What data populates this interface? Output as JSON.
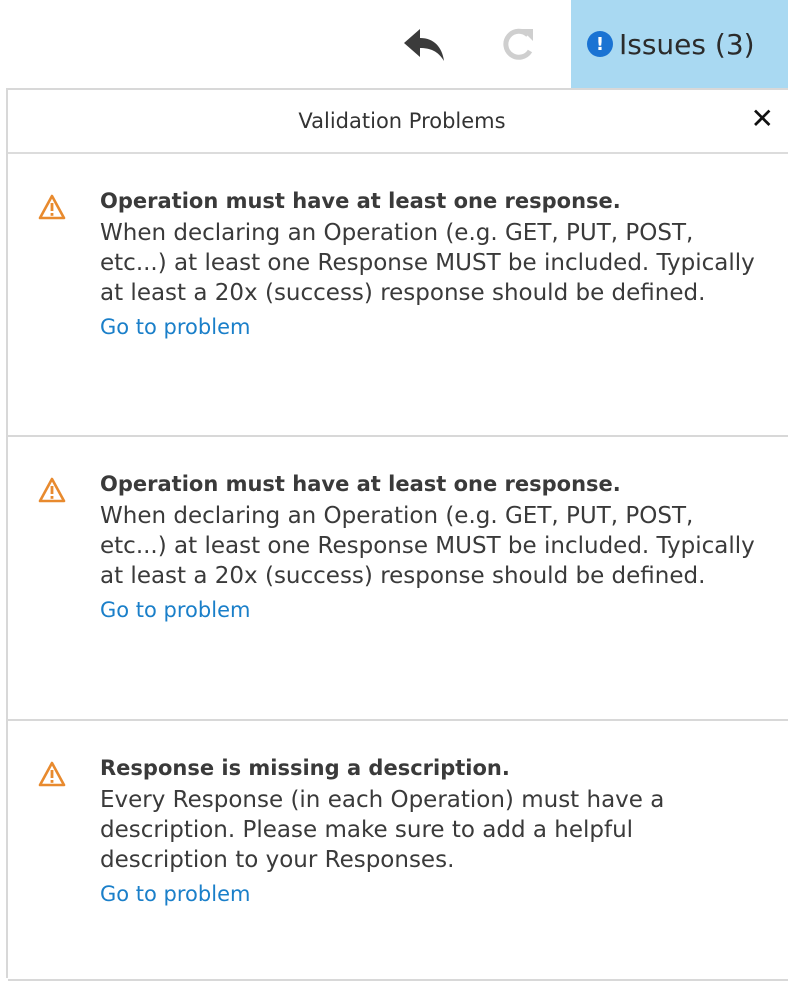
{
  "toolbar": {
    "undo_icon": "undo-arrow-icon",
    "redo_icon": "redo-arrow-icon",
    "issues_label": "Issues (3)",
    "issues_icon": "exclamation-circle-icon",
    "issues_dot_glyph": "!",
    "accent_color": "#a9d9f2"
  },
  "panel": {
    "title": "Validation Problems",
    "close_glyph": "✕"
  },
  "problems": [
    {
      "title": "Operation must have at least one response.",
      "description": "When declaring an Operation (e.g. GET, PUT, POST, etc...) at least one Response MUST be included. Typically at least a 20x (success) response should be defined.",
      "link": "Go to problem",
      "icon": "warning-triangle-icon"
    },
    {
      "title": "Operation must have at least one response.",
      "description": "When declaring an Operation (e.g. GET, PUT, POST, etc...) at least one Response MUST be included. Typically at least a 20x (success) response should be defined.",
      "link": "Go to problem",
      "icon": "warning-triangle-icon"
    },
    {
      "title": "Response is missing a description.",
      "description": "Every Response (in each Operation) must have a description. Please make sure to add a helpful description to your Responses.",
      "link": "Go to problem",
      "icon": "warning-triangle-icon"
    }
  ],
  "colors": {
    "warning": "#e88a2e",
    "link": "#1a7fc9",
    "issues_dot": "#1a73d3"
  }
}
